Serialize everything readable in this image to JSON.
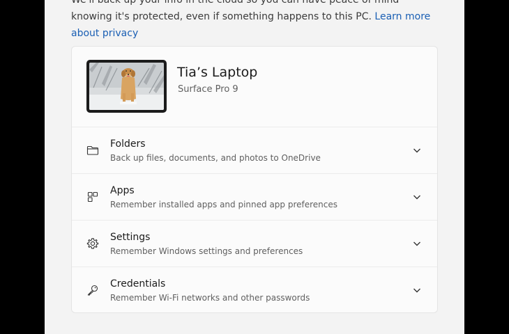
{
  "intro": {
    "text": "We'll back up your info in the cloud so you can have peace of mind knowing it's protected, even if something happens to this PC.",
    "link": "Learn more about privacy"
  },
  "device": {
    "name": "Tia’s Laptop",
    "model": "Surface Pro 9"
  },
  "sections": [
    {
      "title": "Folders",
      "subtitle": "Back up files, documents, and photos to OneDrive",
      "icon": "folder-icon"
    },
    {
      "title": "Apps",
      "subtitle": "Remember installed apps and pinned app preferences",
      "icon": "apps-icon"
    },
    {
      "title": "Settings",
      "subtitle": "Remember Windows settings and preferences",
      "icon": "gear-icon"
    },
    {
      "title": "Credentials",
      "subtitle": "Remember Wi-Fi networks and other passwords",
      "icon": "key-icon"
    }
  ],
  "colors": {
    "accent_link": "#1a5fb4",
    "panel_bg": "#f3f3f3",
    "card_bg": "#fbfbfb"
  }
}
